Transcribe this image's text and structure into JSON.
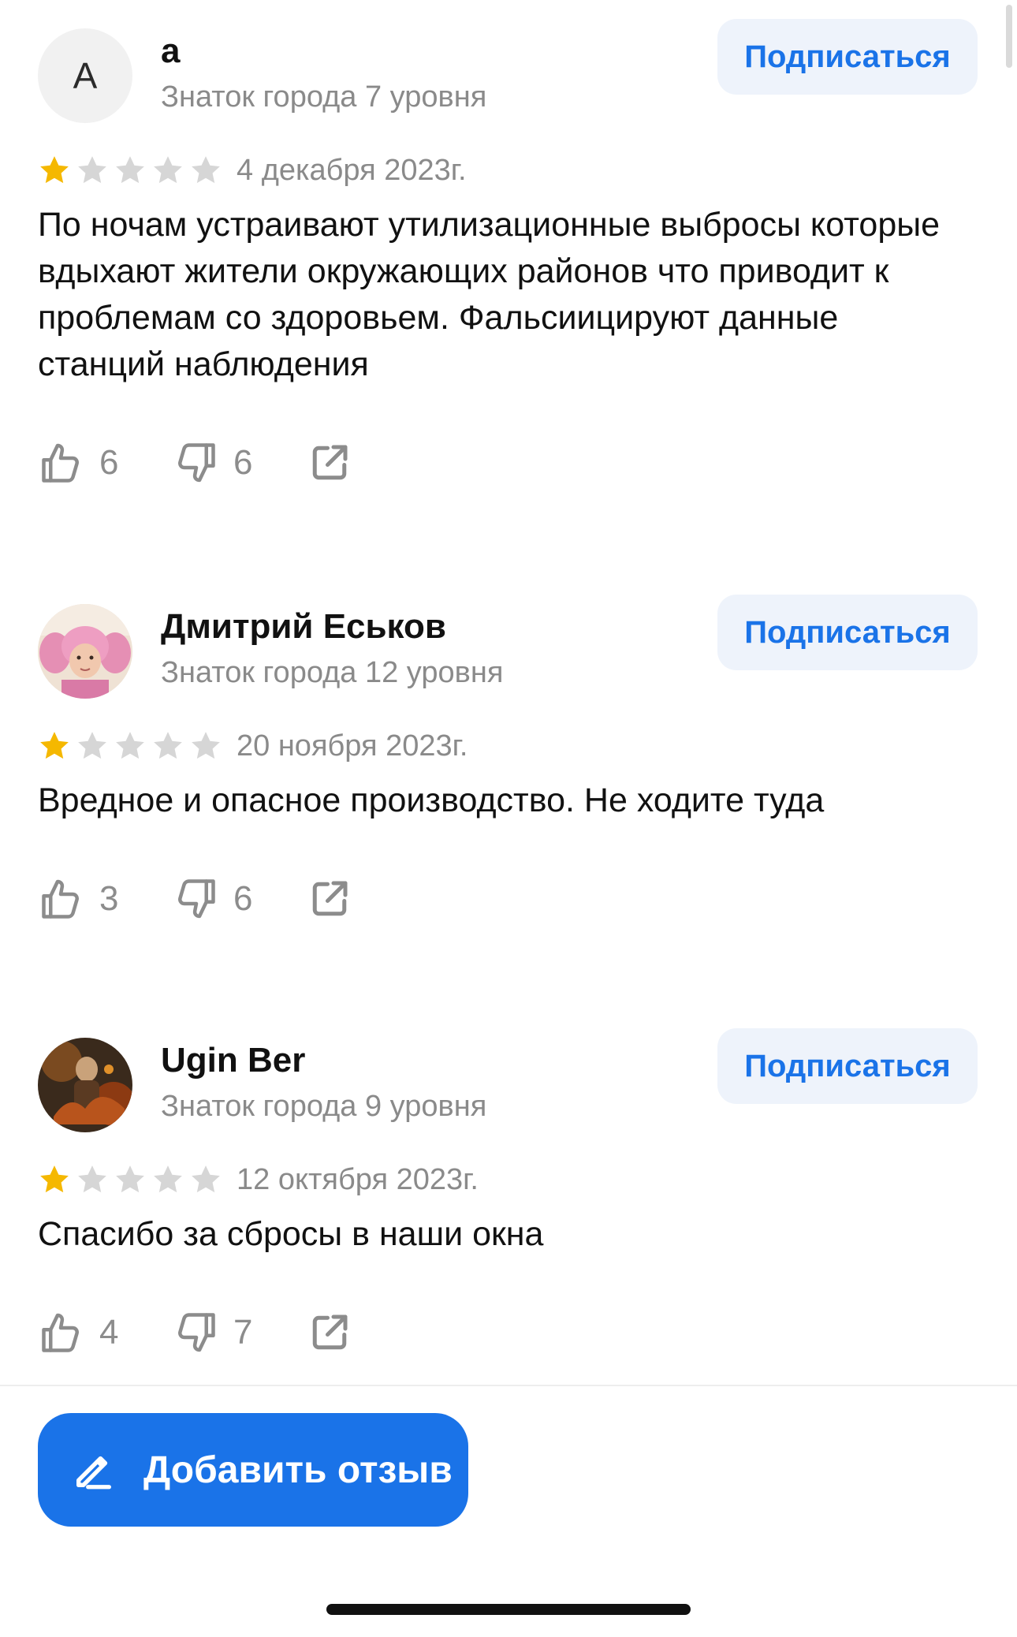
{
  "reviews": [
    {
      "avatar_letter": "A",
      "author": "а",
      "level": "Знаток города 7 уровня",
      "subscribe_label": "Подписаться",
      "rating": 1,
      "date": "4 декабря 2023г.",
      "text": "По ночам устраивают утилизационные выбросы которые вдыхают жители окружающих районов что приводит к проблемам со здоровьем. Фальсиицируют данные станций наблюдения",
      "likes": "6",
      "dislikes": "6"
    },
    {
      "avatar_image": "photo-avatar-pink",
      "author": "Дмитрий Еськов",
      "level": "Знаток города 12 уровня",
      "subscribe_label": "Подписаться",
      "rating": 1,
      "date": "20 ноября 2023г.",
      "text": "Вредное и опасное производство. Не ходите туда",
      "likes": "3",
      "dislikes": "6"
    },
    {
      "avatar_image": "photo-avatar-dark",
      "author": "Ugin Ber",
      "level": "Знаток города 9 уровня",
      "subscribe_label": "Подписаться",
      "rating": 1,
      "date": "12 октября 2023г.",
      "text": "Спасибо за сбросы в наши окна",
      "likes": "4",
      "dislikes": "7"
    }
  ],
  "add_review": {
    "label": "Добавить отзыв",
    "icon": "pencil-icon"
  },
  "colors": {
    "accent": "#1a73e8",
    "star_filled": "#f5b800",
    "star_empty": "#d6d6d6",
    "subscribe_bg": "#eef3fb",
    "muted_text": "#8a8a8a"
  }
}
